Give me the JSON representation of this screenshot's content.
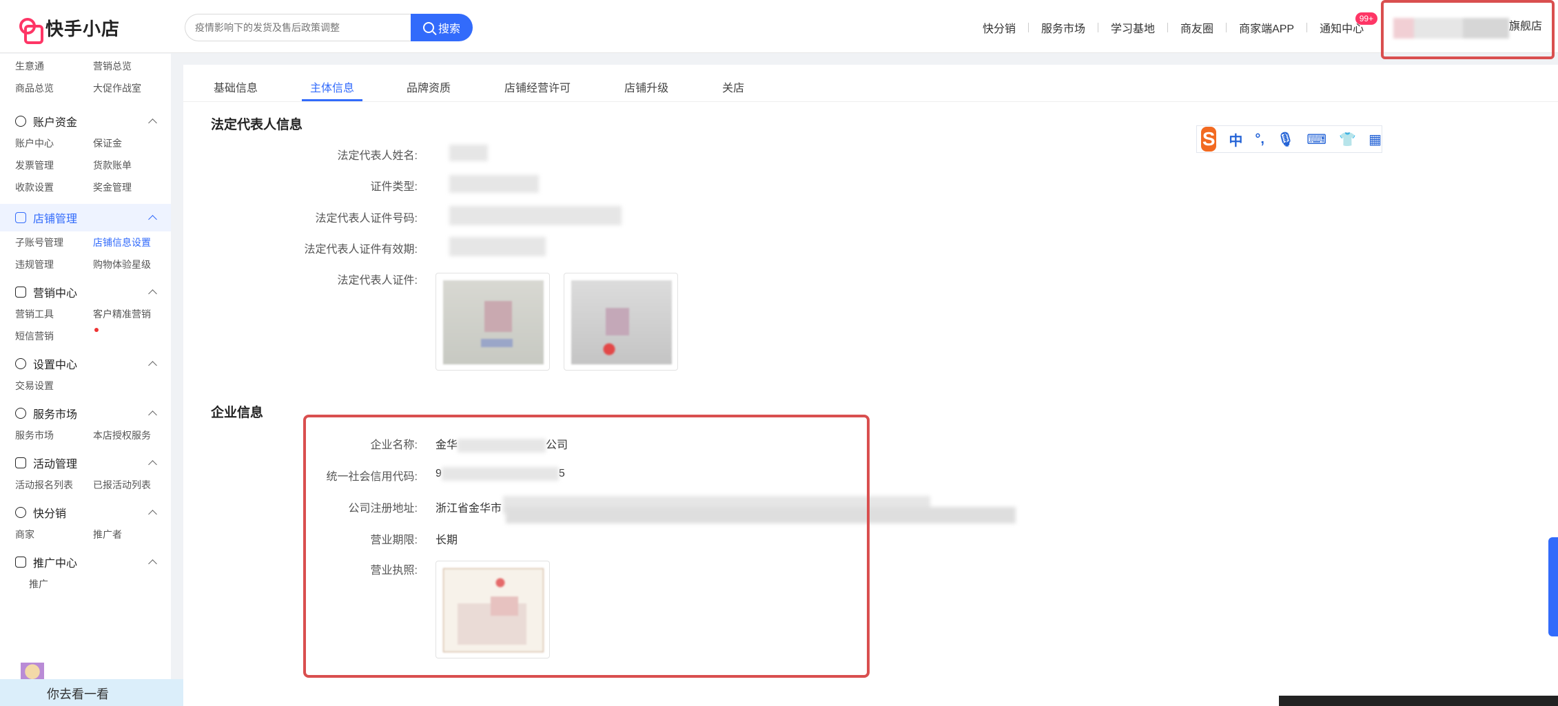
{
  "app": {
    "name": "快手小店"
  },
  "search": {
    "placeholder": "疫情影响下的发货及售后政策调整",
    "button_label": "搜索"
  },
  "topnav": {
    "items": [
      "快分销",
      "服务市场",
      "学习基地",
      "商友圈",
      "商家端APP",
      "通知中心"
    ],
    "notification_badge": "99+",
    "account_suffix": "旗舰店"
  },
  "sidebar": {
    "top_links": [
      "生意通",
      "营销总览",
      "商品总览",
      "大促作战室"
    ],
    "groups": [
      {
        "title": "账户资金",
        "links": [
          "账户中心",
          "保证金",
          "发票管理",
          "货款账单",
          "收款设置",
          "奖金管理"
        ]
      },
      {
        "title": "店铺管理",
        "links": [
          "子账号管理",
          "店铺信息设置",
          "违规管理",
          "购物体验星级"
        ]
      },
      {
        "title": "营销中心",
        "links": [
          "营销工具",
          "客户精准营销",
          "短信营销"
        ]
      },
      {
        "title": "设置中心",
        "links": [
          "交易设置"
        ]
      },
      {
        "title": "服务市场",
        "links": [
          "服务市场",
          "本店授权服务"
        ]
      },
      {
        "title": "活动管理",
        "links": [
          "活动报名列表",
          "已报活动列表"
        ]
      },
      {
        "title": "快分销",
        "links": [
          "商家",
          "推广者"
        ]
      },
      {
        "title": "推广中心",
        "links": [
          "推广"
        ]
      }
    ],
    "chat_text": "你去看一看"
  },
  "tabs": [
    "基础信息",
    "主体信息",
    "品牌资质",
    "店铺经营许可",
    "店铺升级",
    "关店"
  ],
  "ime": {
    "logo": "S",
    "lang": "中",
    "punct": "°,"
  },
  "legal_rep": {
    "title": "法定代表人信息",
    "labels": [
      "法定代表人姓名:",
      "证件类型:",
      "法定代表人证件号码:",
      "法定代表人证件有效期:",
      "法定代表人证件:"
    ]
  },
  "enterprise": {
    "title": "企业信息",
    "labels": [
      "企业名称:",
      "统一社会信用代码:",
      "公司注册地址:",
      "营业期限:",
      "营业执照:"
    ],
    "name_prefix": "金华",
    "name_suffix": "公司",
    "credit_prefix": "9",
    "credit_suffix": "5",
    "address_prefix": "浙江省金华市",
    "term": "长期"
  }
}
